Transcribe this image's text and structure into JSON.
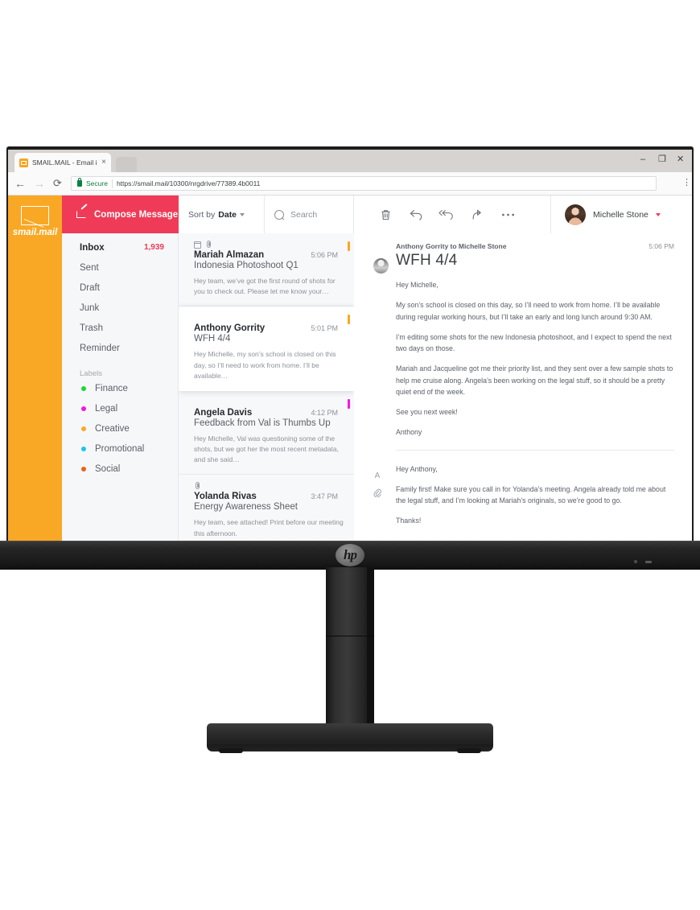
{
  "browser": {
    "tab_title": "SMAIL.MAIL - Email inbo",
    "tab_close": "×",
    "window_minimize": "–",
    "window_maximize": "❐",
    "window_close": "✕",
    "back": "←",
    "forward": "→",
    "reload": "⟳",
    "secure_label": "Secure",
    "url": "https://smail.mail/10300/nrgdrive/77389.4b0011",
    "menu": "⋮"
  },
  "brand": {
    "name": "smail.mail"
  },
  "compose": {
    "label": "Compose Message"
  },
  "sidebar": {
    "folders": [
      {
        "label": "Inbox",
        "count": "1,939",
        "active": true
      },
      {
        "label": "Sent",
        "count": "",
        "active": false
      },
      {
        "label": "Draft",
        "count": "",
        "active": false
      },
      {
        "label": "Junk",
        "count": "",
        "active": false
      },
      {
        "label": "Trash",
        "count": "",
        "active": false
      },
      {
        "label": "Reminder",
        "count": "",
        "active": false
      }
    ],
    "labels_heading": "Labels",
    "labels": [
      {
        "label": "Finance",
        "color": "#18d92a"
      },
      {
        "label": "Legal",
        "color": "#f319e0"
      },
      {
        "label": "Creative",
        "color": "#f9a825"
      },
      {
        "label": "Promotional",
        "color": "#18c8f0"
      },
      {
        "label": "Social",
        "color": "#e8641a"
      }
    ]
  },
  "listbar": {
    "sort_label": "Sort by",
    "sort_value": "Date",
    "search_placeholder": "Search"
  },
  "mails": [
    {
      "from": "Mariah Almazan",
      "time": "5:06 PM",
      "subject": "Indonesia Photoshoot Q1",
      "preview": "Hey team, we’ve got the first round of shots for you to check out. Please let me know your…",
      "flag": "#f9a825",
      "icons": [
        "calendar-icon",
        "attachment-icon"
      ],
      "selected": false
    },
    {
      "from": "Anthony Gorrity",
      "time": "5:01 PM",
      "subject": "WFH 4/4",
      "preview": "Hey Michelle, my son’s school is closed on this day, so I’ll need to work from home. I’ll be available…",
      "flag": "#f9a825",
      "icons": [],
      "selected": true
    },
    {
      "from": "Angela Davis",
      "time": "4:12 PM",
      "subject": "Feedback from Val is Thumbs Up",
      "preview": "Hey Michelle, Val was questioning some of the shots, but we got her the most recent metadata, and she said…",
      "flag": "#f319e0",
      "icons": [],
      "selected": false
    },
    {
      "from": "Yolanda Rivas",
      "time": "3:47 PM",
      "subject": "Energy Awareness Sheet",
      "preview": "Hey team, see attached! Print before our meeting this afternoon.",
      "flag": "",
      "icons": [
        "attachment-icon"
      ],
      "selected": false
    }
  ],
  "actions": [
    {
      "name": "delete-button",
      "title": "Delete"
    },
    {
      "name": "reply-button",
      "title": "Reply"
    },
    {
      "name": "reply-all-button",
      "title": "Reply all"
    },
    {
      "name": "forward-button",
      "title": "Forward"
    },
    {
      "name": "more-options-button",
      "title": "More"
    }
  ],
  "user": {
    "name": "Michelle Stone"
  },
  "message": {
    "meta": "Anthony Gorrity to Michelle Stone",
    "time": "5:06 PM",
    "subject": "WFH 4/4",
    "paragraphs": [
      "Hey Michelle,",
      "My son’s school is closed on this day, so I’ll need to work from home. I’ll be available during regular working hours, but I’ll take an early and long lunch around 9:30 AM.",
      "I’m editing some shots for the new Indonesia photoshoot, and I expect to spend the next two days on those.",
      "Mariah and Jacqueline got me their priority list, and they sent over a few sample shots to help me cruise along. Angela’s been working on the legal stuff, so it should be a pretty quiet end of the week.",
      "See you next week!",
      "Anthony"
    ]
  },
  "reply": {
    "paragraphs": [
      "Hey Anthony,",
      "Family first! Make sure you call in for Yolanda’s meeting. Angela already told me about the legal stuff, and I’m looking at Mariah’s originals, so we’re good to go.",
      "Thanks!"
    ],
    "format_icon": "A",
    "attach_icon": "🔗"
  },
  "hardware": {
    "brand": "hp"
  }
}
